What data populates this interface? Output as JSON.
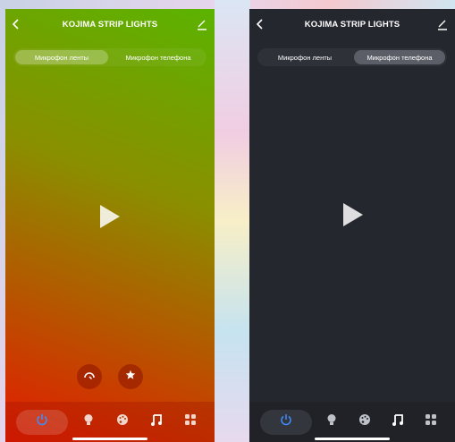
{
  "screens": [
    {
      "title": "KOJIMA STRIP LIGHTS",
      "segments": [
        "Микрофон ленты",
        "Микрофон телефона"
      ],
      "active_segment": 0
    },
    {
      "title": "KOJIMA STRIP LIGHTS",
      "segments": [
        "Микрофон ленты",
        "Микрофон телефона"
      ],
      "active_segment": 1
    }
  ],
  "icons": {
    "back": "back-chevron-icon",
    "edit": "edit-pencil-icon",
    "play": "play-icon",
    "sensitivity": "sensitivity-gauge-icon",
    "favorite": "star-icon",
    "tabs": [
      "power-icon",
      "bulb-icon",
      "palette-icon",
      "music-icon",
      "grid-icon"
    ]
  },
  "colors": {
    "power_active": "#3f8cff",
    "dark_bg": "#25272f"
  }
}
